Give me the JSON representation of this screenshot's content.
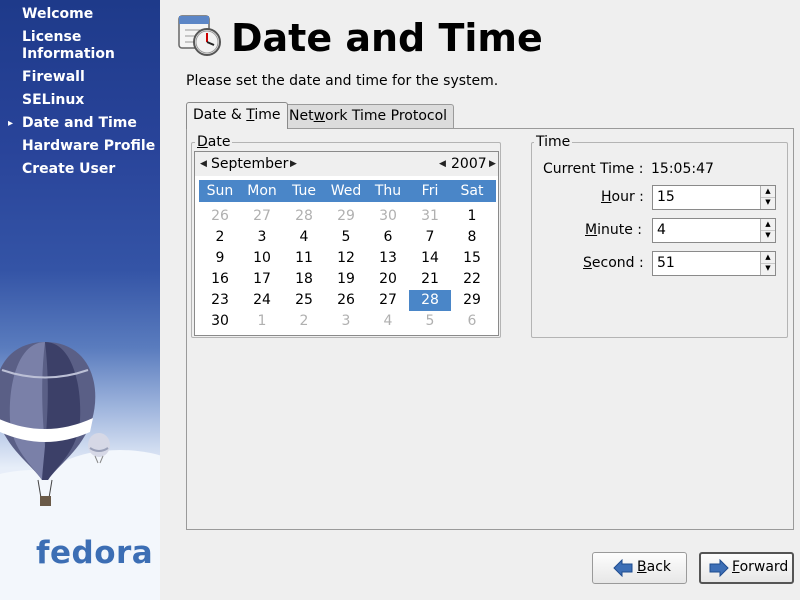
{
  "sidebar": {
    "items": [
      {
        "label": "Welcome",
        "active": false
      },
      {
        "label": "License Information",
        "active": false
      },
      {
        "label": "Firewall",
        "active": false
      },
      {
        "label": "SELinux",
        "active": false
      },
      {
        "label": "Date and Time",
        "active": true
      },
      {
        "label": "Hardware Profile",
        "active": false
      },
      {
        "label": "Create User",
        "active": false
      }
    ],
    "logo_text": "fedora"
  },
  "header": {
    "title": "Date and Time",
    "icon": "calendar-clock-icon"
  },
  "intro_text": "Please set the date and time for the system.",
  "tabs": [
    {
      "label": "Date & Time",
      "mnemonic": "T",
      "active": true
    },
    {
      "label": "Network Time Protocol",
      "mnemonic": "w",
      "active": false
    }
  ],
  "date_section": {
    "label": "Date",
    "month": "September",
    "year": "2007",
    "weekdays": [
      "Sun",
      "Mon",
      "Tue",
      "Wed",
      "Thu",
      "Fri",
      "Sat"
    ],
    "weeks": [
      [
        "26",
        "27",
        "28",
        "29",
        "30",
        "31",
        "1"
      ],
      [
        "2",
        "3",
        "4",
        "5",
        "6",
        "7",
        "8"
      ],
      [
        "9",
        "10",
        "11",
        "12",
        "13",
        "14",
        "15"
      ],
      [
        "16",
        "17",
        "18",
        "19",
        "20",
        "21",
        "22"
      ],
      [
        "23",
        "24",
        "25",
        "26",
        "27",
        "28",
        "29"
      ],
      [
        "30",
        "1",
        "2",
        "3",
        "4",
        "5",
        "6"
      ]
    ],
    "selected_day": "28"
  },
  "time_section": {
    "label": "Time",
    "current_time_label": "Current Time :",
    "current_time": "15:05:47",
    "hour_label": "Hour :",
    "hour": "15",
    "minute_label": "Minute :",
    "minute": "4",
    "second_label": "Second :",
    "second": "51"
  },
  "buttons": {
    "back": "Back",
    "forward": "Forward"
  },
  "colors": {
    "accent": "#4a86c8",
    "sidebar_top": "#1e3a8a",
    "logo": "#3c6eb4"
  }
}
